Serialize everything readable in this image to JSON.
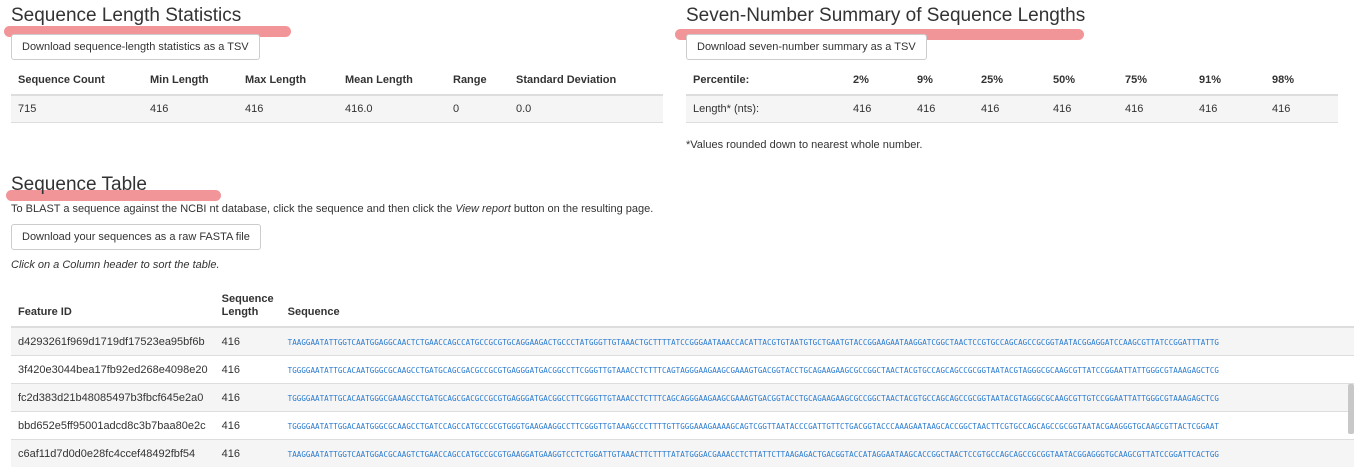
{
  "length_stats": {
    "title": "Sequence Length Statistics",
    "download_label": "Download sequence-length statistics as a TSV",
    "headers": [
      "Sequence Count",
      "Min Length",
      "Max Length",
      "Mean Length",
      "Range",
      "Standard Deviation"
    ],
    "values": [
      "715",
      "416",
      "416",
      "416.0",
      "0",
      "0.0"
    ]
  },
  "seven_number": {
    "title": "Seven-Number Summary of Sequence Lengths",
    "download_label": "Download seven-number summary as a TSV",
    "header_label": "Percentile:",
    "percentiles": [
      "2%",
      "9%",
      "25%",
      "50%",
      "75%",
      "91%",
      "98%"
    ],
    "row_label": "Length* (nts):",
    "lengths": [
      "416",
      "416",
      "416",
      "416",
      "416",
      "416",
      "416"
    ],
    "footnote": "*Values rounded down to nearest whole number."
  },
  "sequence_table": {
    "title": "Sequence Table",
    "intro_before": "To BLAST a sequence against the NCBI nt database, click the sequence and then click the ",
    "intro_em": "View report",
    "intro_after": " button on the resulting page.",
    "download_label": "Download your sequences as a raw FASTA file",
    "sort_hint": "Click on a Column header to sort the table.",
    "headers": {
      "feature_id": "Feature ID",
      "length_line1": "Sequence",
      "length_line2": "Length",
      "sequence": "Sequence"
    },
    "rows": [
      {
        "feature_id": "d4293261f969d1719df17523ea95bf6b",
        "length": "416",
        "sequence": "TAAGGAATATTGGTCAATGGAGGCAACTCTGAACCAGCCATGCCGCGTGCAGGAAGACTGCCCTATGGGTTGTAAACTGCTTTTATCCGGGAATAAACCACATTACGTGTAATGTGCTGAATGTACCGGAAGAATAAGGATCGGCTAACTCCGTGCCAGCAGCCGCGGTAATACGGAGGATCCAAGCGTTATCCGGATTTATTG"
      },
      {
        "feature_id": "3f420e3044bea17fb92ed268e4098e20",
        "length": "416",
        "sequence": "TGGGGAATATTGCACAATGGGCGCAAGCCTGATGCAGCGACGCCGCGTGAGGGATGACGGCCTTCGGGTTGTAAACCTCTTTCAGTAGGGAAGAAGCGAAAGTGACGGTACCTGCAGAAGAAGCGCCGGCTAACTACGTGCCAGCAGCCGCGGTAATACGTAGGGCGCAAGCGTTATCCGGAATTATTGGGCGTAAAGAGCTCG"
      },
      {
        "feature_id": "fc2d383d21b48085497b3fbcf645e2a0",
        "length": "416",
        "sequence": "TGGGGAATATTGCACAATGGGCGAAAGCCTGATGCAGCGACGCCGCGTGAGGGATGACGGCCTTCGGGTTGTAAACCTCTTTCAGCAGGGAAGAAGCGAAAGTGACGGTACCTGCAGAAGAAGCGCCGGCTAACTACGTGCCAGCAGCCGCGGTAATACGTAGGGCGCAAGCGTTGTCCGGAATTATTGGGCGTAAAGAGCTCG"
      },
      {
        "feature_id": "bbd652e5ff95001adcd8c3b7baa80e2c",
        "length": "416",
        "sequence": "TGGGGAATATTGGACAATGGGCGCAAGCCTGATCCAGCCATGCCGCGTGGGTGAAGAAGGCCTTCGGGTTGTAAAGCCCTTTTGTTGGGAAAGAAAAGCAGTCGGTTAATACCCGATTGTTCTGACGGTACCCAAAGAATAAGCACCGGCTAACTTCGTGCCAGCAGCCGCGGTAATACGAAGGGTGCAAGCGTTACTCGGAAT"
      },
      {
        "feature_id": "c6af11d7d0d0e28fc4ccef48492fbf54",
        "length": "416",
        "sequence": "TAAGGAATATTGGTCAATGGACGCAAGTCTGAACCAGCCATGCCGCGTGAAGGATGAAGGTCCTCTGGATTGTAAACTTCTTTTATATGGGACGAAACCTCTTATTCTTAAGAGACTGACGGTACCATAGGAATAAGCACCGGCTAACTCCGTGCCAGCAGCCGCGGTAATACGGAGGGTGCAAGCGTTATCCGGATTCACTGG"
      }
    ]
  },
  "colors": {
    "highlight": "#ef8a8d",
    "link": "#2a7bd0",
    "stripe": "#f5f5f5",
    "border": "#dddddd"
  }
}
